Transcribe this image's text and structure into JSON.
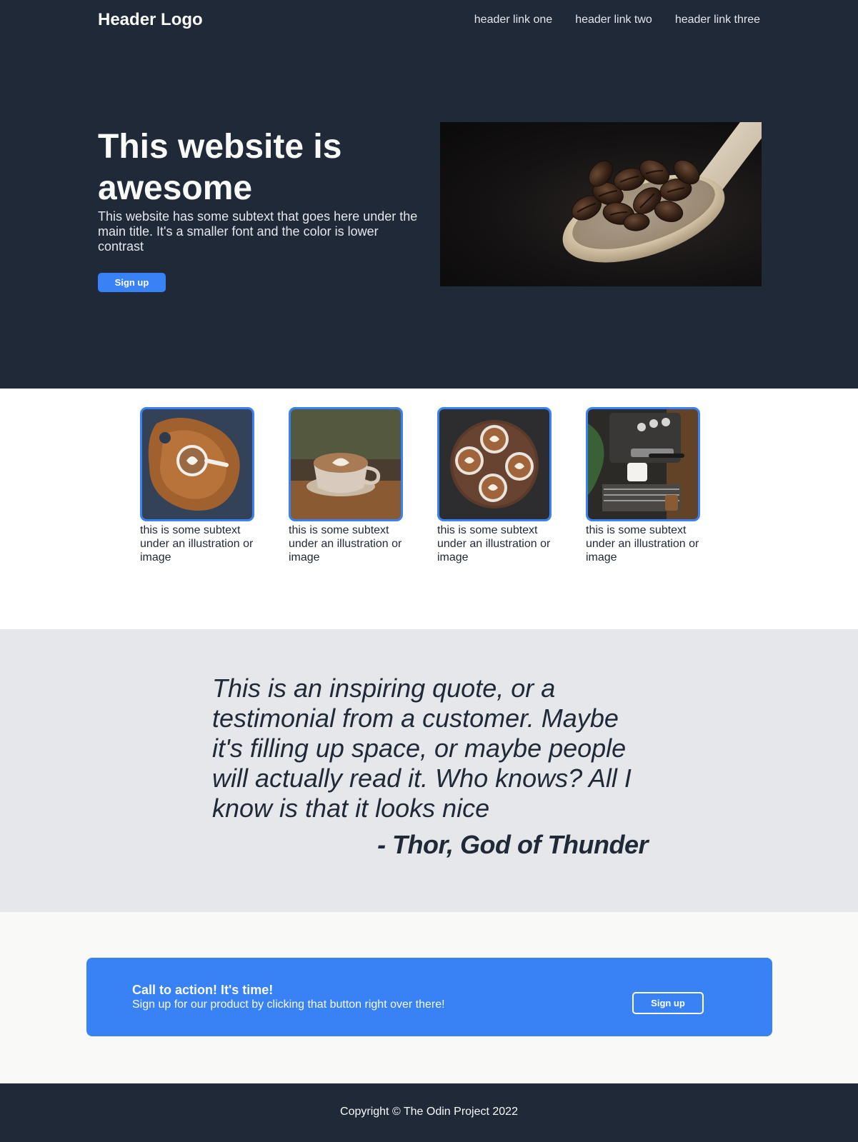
{
  "header": {
    "logo": "Header Logo",
    "links": [
      "header link one",
      "header link two",
      "header link three"
    ]
  },
  "hero": {
    "title": "This website is awesome",
    "subtitle": "This website has some subtext that goes here under the main title. It's a smaller font and the color is lower contrast",
    "button_label": "Sign up",
    "image_icon": "coffee-beans-spoon-image"
  },
  "info": {
    "cards": [
      {
        "text": "this is some subtext under an illustration or image",
        "image_icon": "latte-on-wooden-board-image"
      },
      {
        "text": "this is some subtext under an illustration or image",
        "image_icon": "cappuccino-cup-image"
      },
      {
        "text": "this is some subtext under an illustration or image",
        "image_icon": "four-lattes-on-table-image"
      },
      {
        "text": "this is some subtext under an illustration or image",
        "image_icon": "espresso-machine-image"
      }
    ]
  },
  "quote": {
    "text": "This is an inspiring quote, or a testimonial from a customer. Maybe it's filling up space, or maybe people will actually read it. Who knows? All I know is that it looks nice",
    "author": "- Thor, God of Thunder"
  },
  "cta": {
    "title": "Call to action! It's time!",
    "subtitle": "Sign up for our product by clicking that button right over there!",
    "button_label": "Sign up"
  },
  "footer": {
    "text": "Copyright © The Odin Project 2022"
  },
  "colors": {
    "dark": "#1f2937",
    "accent": "#3882f6",
    "light_gray": "#e5e7eb",
    "off_white": "#f9faf8"
  }
}
